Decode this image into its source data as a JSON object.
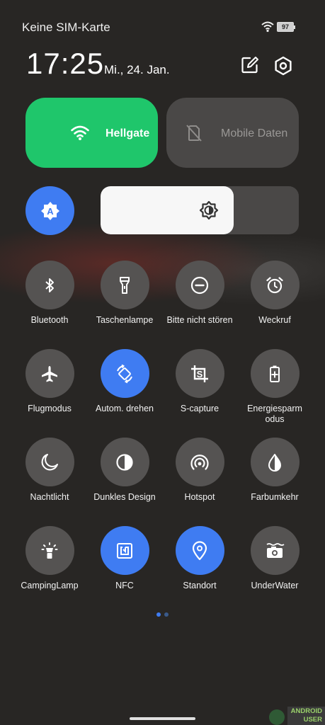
{
  "status_bar": {
    "carrier": "Keine SIM-Karte",
    "battery": "97",
    "wifi_icon": "wifi-signal-icon"
  },
  "header": {
    "time": "17:25",
    "date": "Mi., 24. Jan.",
    "edit_icon": "edit-icon",
    "settings_icon": "settings-icon"
  },
  "big_tiles": {
    "wifi": {
      "label": "Hellgate",
      "icon": "wifi-icon",
      "state": "on",
      "color": "#1fc66b"
    },
    "mobile": {
      "label": "Mobile Daten",
      "icon": "mobile-data-off-icon",
      "state": "off"
    }
  },
  "brightness": {
    "auto_icon": "auto-brightness-icon",
    "level": 0.67
  },
  "tiles": [
    {
      "label": "Bluetooth",
      "icon": "bluetooth-icon",
      "active": false
    },
    {
      "label": "Taschenlampe",
      "icon": "flashlight-icon",
      "active": false
    },
    {
      "label": "Bitte nicht stören",
      "icon": "do-not-disturb-icon",
      "active": false
    },
    {
      "label": "Weckruf",
      "icon": "alarm-icon",
      "active": false
    },
    {
      "label": "Flugmodus",
      "icon": "airplane-icon",
      "active": false
    },
    {
      "label": "Autom. drehen",
      "icon": "auto-rotate-icon",
      "active": true
    },
    {
      "label": "S-capture",
      "icon": "screenshot-icon",
      "active": false
    },
    {
      "label": "Energiesparm odus",
      "icon": "battery-saver-icon",
      "active": false
    },
    {
      "label": "Nachtlicht",
      "icon": "moon-icon",
      "active": false
    },
    {
      "label": "Dunkles Design",
      "icon": "dark-mode-icon",
      "active": false
    },
    {
      "label": "Hotspot",
      "icon": "hotspot-icon",
      "active": false
    },
    {
      "label": "Farbumkehr",
      "icon": "color-inversion-icon",
      "active": false
    },
    {
      "label": "CampingLamp",
      "icon": "camping-lamp-icon",
      "active": false
    },
    {
      "label": "NFC",
      "icon": "nfc-icon",
      "active": true
    },
    {
      "label": "Standort",
      "icon": "location-icon",
      "active": true
    },
    {
      "label": "UnderWater",
      "icon": "underwater-camera-icon",
      "active": false
    }
  ],
  "pager": {
    "pages": 2,
    "current": 1
  },
  "watermark": {
    "line1": "ANDROID",
    "line2": "USER"
  },
  "colors": {
    "accent": "#3f7cf2",
    "tile_off": "#555352",
    "background": "#282624"
  }
}
